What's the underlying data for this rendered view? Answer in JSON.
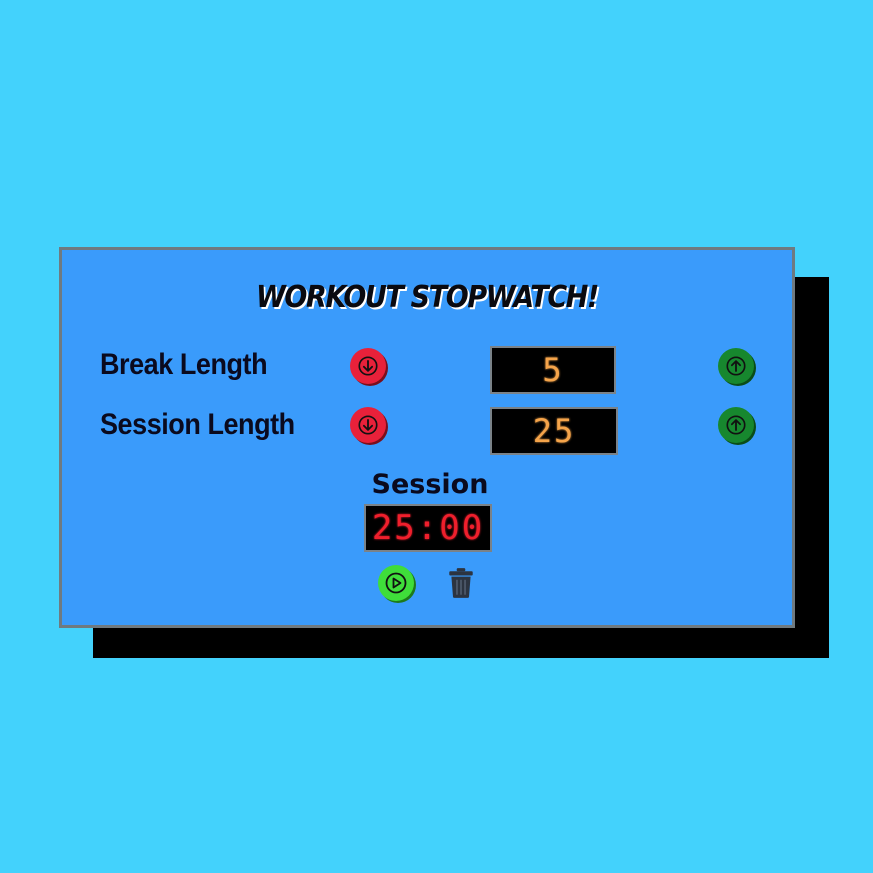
{
  "app": {
    "title": "WORKOUT STOPWATCH!"
  },
  "break": {
    "label": "Break Length",
    "value": "5",
    "decrement_icon": "arrow-down-circle-icon",
    "increment_icon": "arrow-up-circle-icon"
  },
  "session": {
    "label": "Session Length",
    "value": "25",
    "decrement_icon": "arrow-down-circle-icon",
    "increment_icon": "arrow-up-circle-icon"
  },
  "timer": {
    "label": "Session",
    "display": "25:00"
  },
  "controls": {
    "play_icon": "play-icon",
    "reset_icon": "trash-icon"
  },
  "colors": {
    "background": "#43d2fc",
    "panel": "#3a9bfb",
    "decrement": "#e8213a",
    "increment": "#17872e",
    "play": "#3fdd3a",
    "lcd_digits": "#f5a44a",
    "timer_digits": "#ef1f2c"
  }
}
